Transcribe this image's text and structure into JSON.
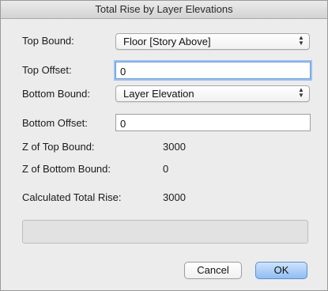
{
  "window": {
    "title": "Total Rise by Layer Elevations"
  },
  "form": {
    "top_bound": {
      "label": "Top Bound:",
      "value": "Floor [Story Above]"
    },
    "top_offset": {
      "label": "Top Offset:",
      "value": "0"
    },
    "bottom_bound": {
      "label": "Bottom Bound:",
      "value": "Layer Elevation"
    },
    "bottom_offset": {
      "label": "Bottom Offset:",
      "value": "0"
    },
    "z_top": {
      "label": "Z of Top Bound:",
      "value": "3000"
    },
    "z_bottom": {
      "label": "Z of Bottom Bound:",
      "value": "0"
    },
    "total_rise": {
      "label": "Calculated Total Rise:",
      "value": "3000"
    }
  },
  "buttons": {
    "cancel": "Cancel",
    "ok": "OK"
  },
  "colors": {
    "default_button": "#8fbdf2",
    "focus_ring": "#9cc1ef"
  },
  "icons": {
    "popup_arrows": "up-down-chevron-icon"
  }
}
